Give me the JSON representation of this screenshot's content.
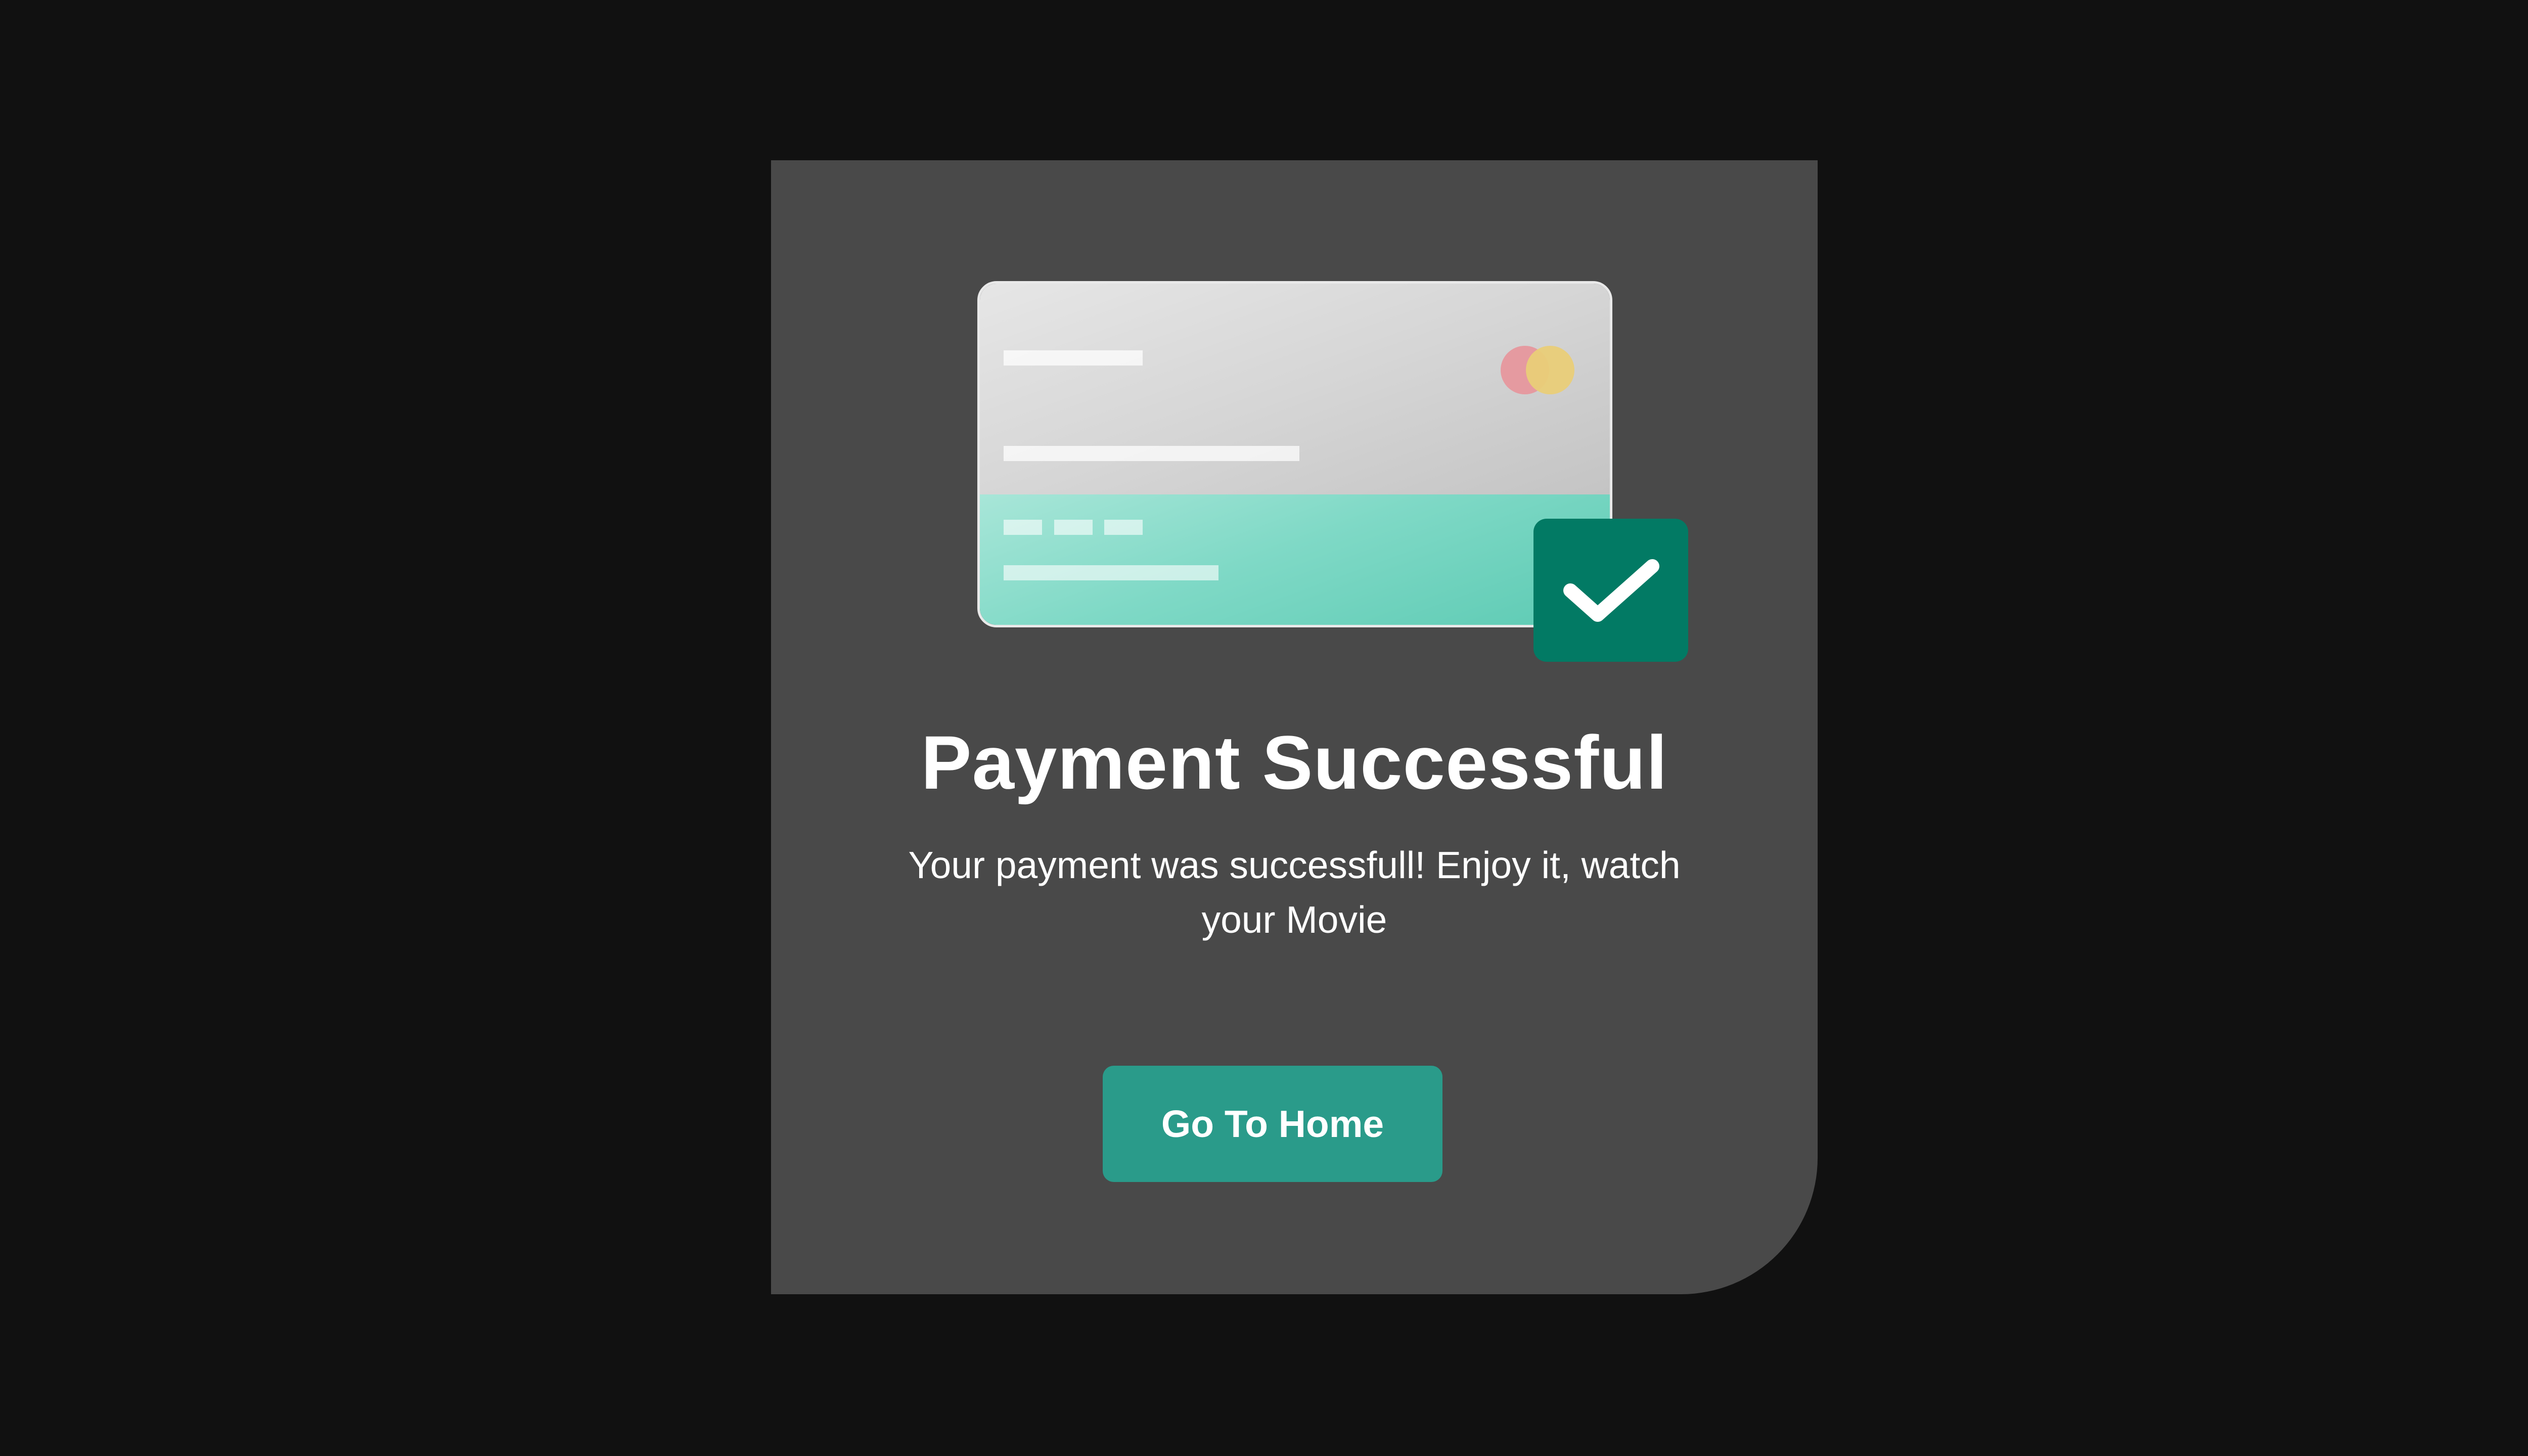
{
  "dialog": {
    "title": "Payment Successful",
    "message": "Your payment was successfull! Enjoy it, watch your Movie",
    "button_label": "Go To Home"
  },
  "illustration": {
    "card_icon": "credit-card-icon",
    "check_icon": "checkmark-icon",
    "card_brand_icon": "card-brand-logo-icon"
  },
  "colors": {
    "background": "#111111",
    "dialog_background": "#494949",
    "accent": "#2a9b8a",
    "check_badge": "#027a64",
    "card_top": "#d6d6d6",
    "card_bottom": "#7fd9c6"
  }
}
